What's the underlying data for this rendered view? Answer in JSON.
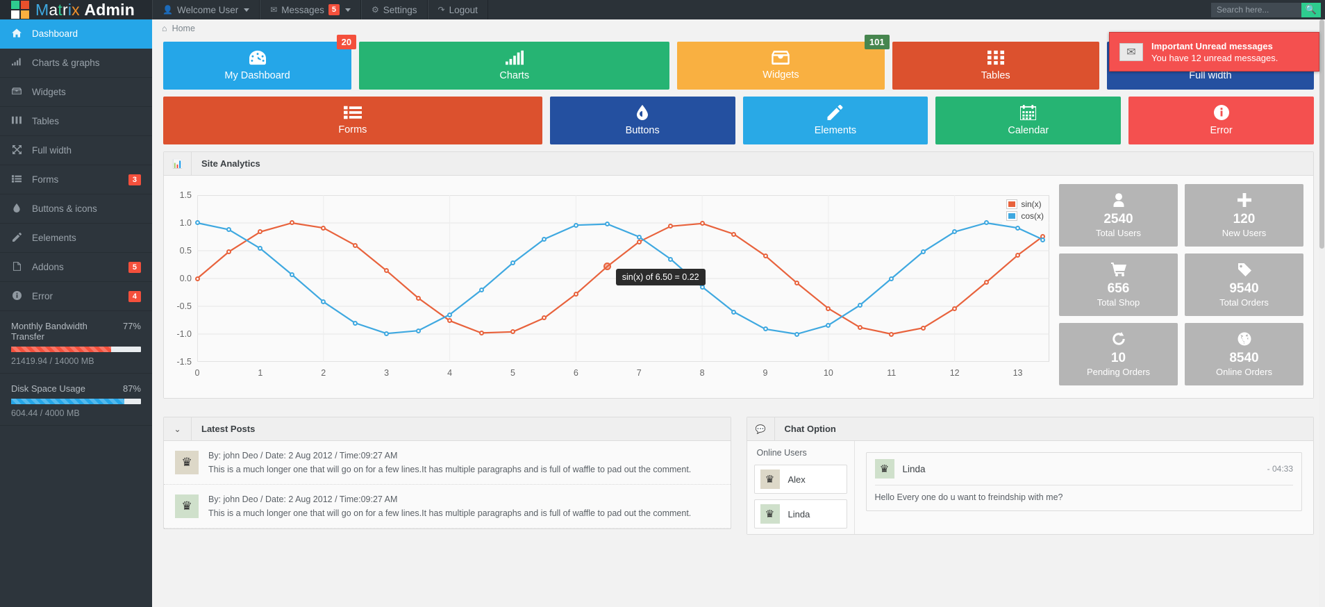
{
  "brand": {
    "name_parts": [
      "M",
      "a",
      "t",
      "r",
      "i",
      "x"
    ],
    "name_bold": "Admin",
    "logo_colors": [
      "#2ecc8f",
      "#e8502c",
      "#ffffff",
      "#fbb040"
    ]
  },
  "topnav": {
    "items": [
      {
        "label": "Welcome User",
        "icon": "user-icon",
        "caret": true,
        "badge": null
      },
      {
        "label": "Messages",
        "icon": "envelope-icon",
        "caret": true,
        "badge": "5"
      },
      {
        "label": "Settings",
        "icon": "gear-icon",
        "caret": false,
        "badge": null
      },
      {
        "label": "Logout",
        "icon": "logout-icon",
        "caret": false,
        "badge": null
      }
    ],
    "search": {
      "placeholder": "Search here...",
      "value": "",
      "button_icon": "search-icon"
    }
  },
  "breadcrumb": {
    "icon": "home-icon",
    "label": "Home"
  },
  "sidebar": {
    "items": [
      {
        "label": "Dashboard",
        "icon": "home-icon",
        "badge": null,
        "active": true
      },
      {
        "label": "Charts & graphs",
        "icon": "bar-chart-icon",
        "badge": null,
        "active": false
      },
      {
        "label": "Widgets",
        "icon": "inbox-icon",
        "badge": null,
        "active": false
      },
      {
        "label": "Tables",
        "icon": "table-icon",
        "badge": null,
        "active": false
      },
      {
        "label": "Full width",
        "icon": "expand-icon",
        "badge": null,
        "active": false
      },
      {
        "label": "Forms",
        "icon": "list-icon",
        "badge": "3",
        "active": false
      },
      {
        "label": "Buttons & icons",
        "icon": "droplet-icon",
        "badge": null,
        "active": false
      },
      {
        "label": "Eelements",
        "icon": "pencil-icon",
        "badge": null,
        "active": false
      },
      {
        "label": "Addons",
        "icon": "file-icon",
        "badge": "5",
        "active": false
      },
      {
        "label": "Error",
        "icon": "info-icon",
        "badge": "4",
        "active": false
      }
    ],
    "meters": [
      {
        "title": "Monthly Bandwidth Transfer",
        "percent": "77%",
        "fill": 77,
        "sub": "21419.94 / 14000 MB",
        "color": "#f4503c"
      },
      {
        "title": "Disk Space Usage",
        "percent": "87%",
        "fill": 87,
        "sub": "604.44 / 4000 MB",
        "color": "#25a6e8"
      }
    ]
  },
  "tiles_row1": [
    {
      "label": "My Dashboard",
      "icon": "dashboard-icon",
      "glyph": "◉",
      "color": "#25a6e8",
      "badge": "20",
      "badge_color": "red",
      "flex": 2
    },
    {
      "label": "Charts",
      "icon": "bar-chart-icon",
      "glyph": "▁▃▅▇",
      "color": "#26b473",
      "badge": null,
      "badge_color": null,
      "flex": 3.3
    },
    {
      "label": "Widgets",
      "icon": "inbox-icon",
      "glyph": "⌂",
      "color": "#f9b041",
      "badge": "101",
      "badge_color": "green",
      "flex": 2.2
    },
    {
      "label": "Tables",
      "icon": "grid-icon",
      "glyph": "▦",
      "color": "#dc512e",
      "badge": null,
      "badge_color": null,
      "flex": 2.2
    },
    {
      "label": "Full width",
      "icon": "expand-icon",
      "glyph": "✥",
      "color": "#2450a0",
      "badge": null,
      "badge_color": null,
      "flex": 2.2
    }
  ],
  "tiles_row2": [
    {
      "label": "Forms",
      "icon": "list-icon",
      "glyph": "☰",
      "color": "#dc512e",
      "flex": 4.5
    },
    {
      "label": "Buttons",
      "icon": "droplet-icon",
      "glyph": "💧",
      "color": "#2450a0",
      "flex": 2.2
    },
    {
      "label": "Elements",
      "icon": "pencil-icon",
      "glyph": "✎",
      "color": "#29a9e6",
      "flex": 2.2
    },
    {
      "label": "Calendar",
      "icon": "calendar-icon",
      "glyph": "▤",
      "color": "#26b473",
      "flex": 2.2
    },
    {
      "label": "Error",
      "icon": "info-icon",
      "glyph": "ⓘ",
      "color": "#f4504f",
      "flex": 2.2
    }
  ],
  "analytics": {
    "title": "Site Analytics",
    "icon": "bar-chart-icon"
  },
  "chart_data": {
    "type": "line",
    "title": "Site Analytics",
    "xlabel": "",
    "ylabel": "",
    "xlim": [
      0,
      13.5
    ],
    "ylim": [
      -1.5,
      1.5
    ],
    "grid": true,
    "legend_position": "top-right",
    "xticks": [
      0,
      1,
      2,
      3,
      4,
      5,
      6,
      7,
      8,
      9,
      10,
      11,
      12,
      13
    ],
    "yticks": [
      1.5,
      1.0,
      0.5,
      0.0,
      -0.5,
      -1.0,
      -1.5
    ],
    "x": [
      0,
      0.5,
      1,
      1.5,
      2,
      2.5,
      3,
      3.5,
      4,
      4.5,
      5,
      5.5,
      6,
      6.5,
      7,
      7.5,
      8,
      8.5,
      9,
      9.5,
      10,
      10.5,
      11,
      11.5,
      12,
      12.5,
      13,
      13.4
    ],
    "series": [
      {
        "name": "sin(x)",
        "color": "#e8623c",
        "values": [
          0.0,
          0.48,
          0.84,
          1.0,
          0.91,
          0.6,
          0.14,
          -0.35,
          -0.76,
          -0.98,
          -0.96,
          -0.71,
          -0.28,
          0.22,
          0.66,
          0.94,
          0.99,
          0.8,
          0.41,
          -0.08,
          -0.54,
          -0.88,
          -1.0,
          -0.89,
          -0.54,
          -0.07,
          0.42,
          0.76
        ]
      },
      {
        "name": "cos(x)",
        "color": "#3ea8e0",
        "values": [
          1.0,
          0.88,
          0.54,
          0.07,
          -0.42,
          -0.8,
          -0.99,
          -0.94,
          -0.65,
          -0.21,
          0.28,
          0.71,
          0.96,
          0.98,
          0.75,
          0.35,
          -0.15,
          -0.6,
          -0.91,
          -1.0,
          -0.84,
          -0.48,
          0.0,
          0.48,
          0.84,
          1.0,
          0.91,
          0.7
        ]
      }
    ],
    "tooltip": {
      "text": "sin(x) of 6.50 = 0.22",
      "x": 6.5,
      "y": 0.22,
      "series": "sin(x)"
    }
  },
  "stats": [
    {
      "value": "2540",
      "label": "Total Users",
      "icon": "user-icon",
      "glyph": "👤"
    },
    {
      "value": "120",
      "label": "New Users",
      "icon": "plus-icon",
      "glyph": "✚"
    },
    {
      "value": "656",
      "label": "Total Shop",
      "icon": "cart-icon",
      "glyph": "🛒"
    },
    {
      "value": "9540",
      "label": "Total Orders",
      "icon": "tag-icon",
      "glyph": "🏷"
    },
    {
      "value": "10",
      "label": "Pending Orders",
      "icon": "refresh-icon",
      "glyph": "↻"
    },
    {
      "value": "8540",
      "label": "Online Orders",
      "icon": "globe-icon",
      "glyph": "🌐"
    }
  ],
  "latest_posts": {
    "title": "Latest Posts",
    "collapse_icon": "chevron-down-icon",
    "posts": [
      {
        "meta": "By: john Deo / Date: 2 Aug 2012 / Time:09:27 AM",
        "text": "This is a much longer one that will go on for a few lines.It has multiple paragraphs and is full of waffle to pad out the comment.",
        "avatar_color": "beige",
        "avatar_icon": "crown-icon"
      },
      {
        "meta": "By: john Deo / Date: 2 Aug 2012 / Time:09:27 AM",
        "text": "This is a much longer one that will go on for a few lines.It has multiple paragraphs and is full of waffle to pad out the comment.",
        "avatar_color": "green",
        "avatar_icon": "crown-icon"
      }
    ]
  },
  "chat": {
    "title": "Chat Option",
    "icon": "comment-icon",
    "online_title": "Online Users",
    "online_users": [
      {
        "name": "Alex",
        "avatar_color": "beige",
        "avatar_icon": "crown-icon"
      },
      {
        "name": "Linda",
        "avatar_color": "green",
        "avatar_icon": "crown-icon"
      }
    ],
    "messages": [
      {
        "name": "Linda",
        "time": "- 04:33",
        "text": "Hello Every one do u want to freindship with me?",
        "avatar_color": "green",
        "avatar_icon": "crown-icon"
      }
    ]
  },
  "toast": {
    "icon": "envelope-icon",
    "title": "Important Unread messages",
    "subtitle": "You have 12 unread messages."
  }
}
